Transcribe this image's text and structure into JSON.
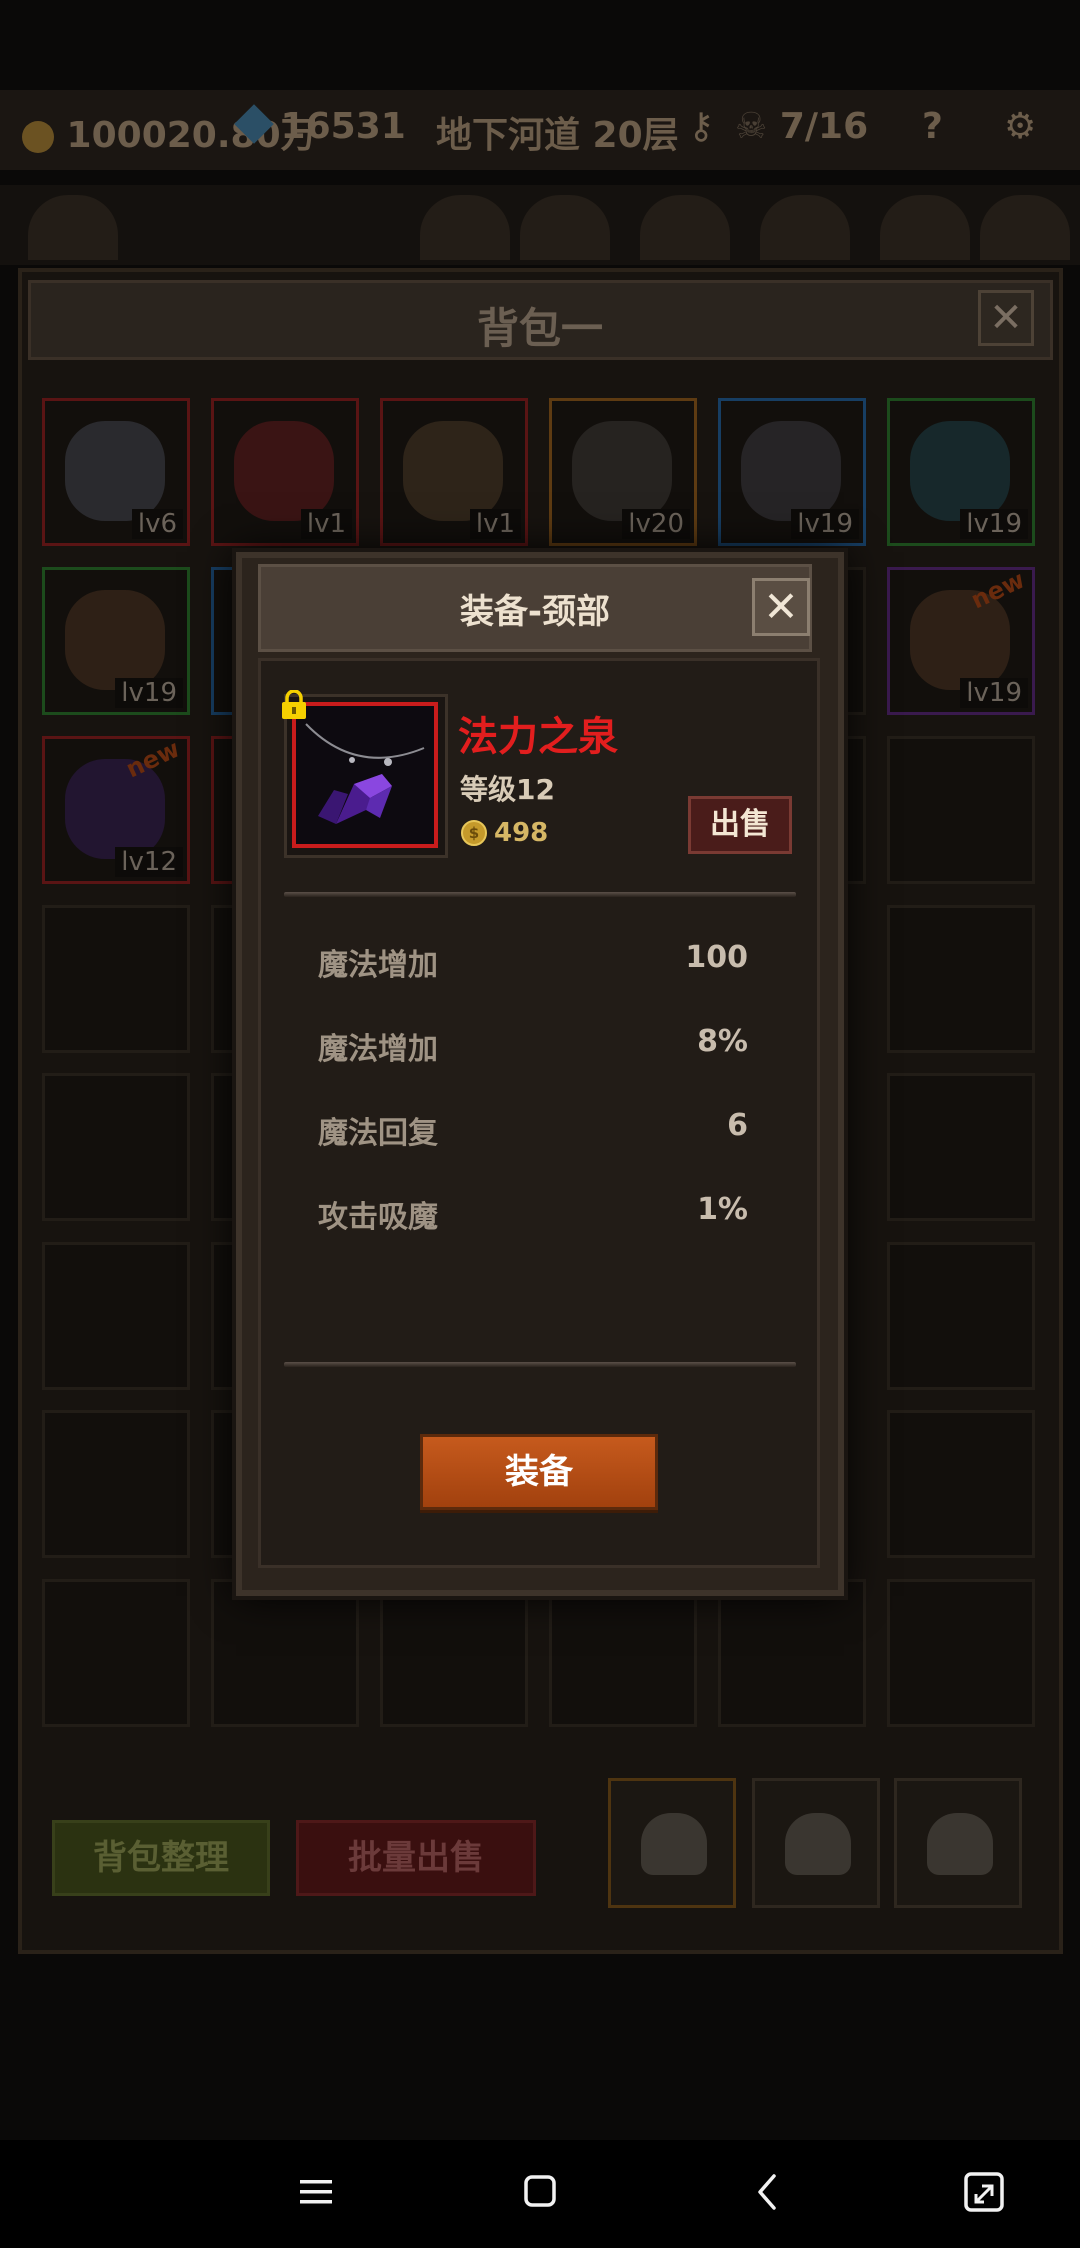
{
  "top_bar": {
    "gold": "100020.80万",
    "gems": "16531",
    "location": "地下河道 20层",
    "dungeon_progress": "7/16",
    "help_label": "?"
  },
  "bag": {
    "title": "背包一",
    "close_glyph": "✕",
    "slots": [
      {
        "item": "helmet",
        "level": "lv6",
        "rarity_color": "#5a1414"
      },
      {
        "item": "gauntlet",
        "level": "lv1",
        "rarity_color": "#5a1414"
      },
      {
        "item": "shield",
        "level": "lv1",
        "rarity_color": "#5a1414"
      },
      {
        "item": "dagger",
        "level": "lv20",
        "rarity_color": "#5e3b12"
      },
      {
        "item": "chest-armor",
        "level": "lv19",
        "rarity_color": "#173e63"
      },
      {
        "item": "amulet",
        "level": "lv19",
        "rarity_color": "#1c4b1c"
      },
      {
        "item": "leather-helmet",
        "level": "lv19",
        "rarity_color": "#1c4b1c"
      },
      {
        "item": "leather-helmet-new",
        "level": "lv19",
        "rarity_color": "#3a1a4e",
        "badge": "new"
      },
      {
        "item": "crystal-necklace",
        "level": "lv12",
        "rarity_color": "#5a1414",
        "badge": "new"
      }
    ],
    "sort_label": "背包整理",
    "bulk_sell_label": "批量出售"
  },
  "dialog": {
    "title": "装备-颈部",
    "close_glyph": "✕",
    "item": {
      "name": "法力之泉",
      "level": "等级12",
      "price": "498",
      "locked": true,
      "icon": "purple-crystal-necklace-icon",
      "rarity_color": "#c81c1c"
    },
    "sell_label": "出售",
    "stats": [
      {
        "label": "魔法增加",
        "value": "100"
      },
      {
        "label": "魔法增加",
        "value": "8%"
      },
      {
        "label": "魔法回复",
        "value": "6"
      },
      {
        "label": "攻击吸魔",
        "value": "1%"
      }
    ],
    "equip_label": "装备"
  },
  "colors": {
    "name_red": "#e21e1e",
    "equip_orange": "#c65a1d",
    "price_gold": "#d6b765"
  }
}
